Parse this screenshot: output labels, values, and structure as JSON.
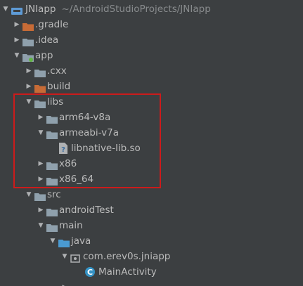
{
  "project_tree": {
    "highlight_color": "#cc1b1b",
    "rows": [
      {
        "kind": "root-module",
        "expanded": true,
        "label": "JNIapp",
        "path": "~/AndroidStudioProjects/JNIapp"
      },
      {
        "kind": "folder-orange",
        "expanded": false,
        "label": ".gradle"
      },
      {
        "kind": "folder",
        "expanded": false,
        "label": ".idea"
      },
      {
        "kind": "module-folder",
        "expanded": true,
        "label": "app"
      },
      {
        "kind": "folder",
        "expanded": false,
        "label": ".cxx"
      },
      {
        "kind": "folder-orange",
        "expanded": false,
        "label": "build"
      },
      {
        "kind": "folder",
        "expanded": true,
        "label": "libs"
      },
      {
        "kind": "folder",
        "expanded": false,
        "label": "arm64-v8a"
      },
      {
        "kind": "folder",
        "expanded": true,
        "label": "armeabi-v7a"
      },
      {
        "kind": "file-unknown",
        "expanded": null,
        "label": "libnative-lib.so"
      },
      {
        "kind": "folder",
        "expanded": false,
        "label": "x86"
      },
      {
        "kind": "folder",
        "expanded": false,
        "label": "x86_64"
      },
      {
        "kind": "folder",
        "expanded": true,
        "label": "src"
      },
      {
        "kind": "folder",
        "expanded": false,
        "label": "androidTest"
      },
      {
        "kind": "folder",
        "expanded": true,
        "label": "main"
      },
      {
        "kind": "folder-blue",
        "expanded": true,
        "label": "java"
      },
      {
        "kind": "package",
        "expanded": true,
        "label": "com.erev0s.jniapp"
      },
      {
        "kind": "class",
        "expanded": null,
        "label": "MainActivity"
      }
    ]
  }
}
